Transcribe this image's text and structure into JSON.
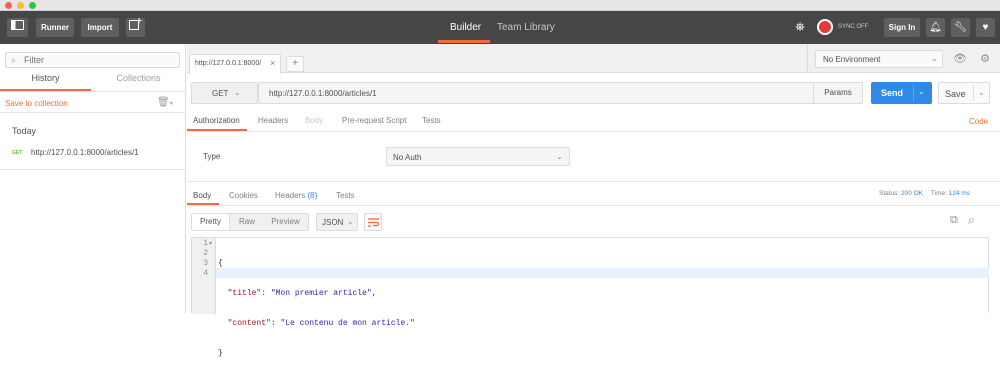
{
  "header": {
    "runner": "Runner",
    "import": "Import",
    "builder": "Builder",
    "team_library": "Team Library",
    "sync": "SYNC OFF",
    "sign_in": "Sign In"
  },
  "sidebar": {
    "filter_placeholder": "Filter",
    "tabs": [
      "History",
      "Collections"
    ],
    "save_to_collection": "Save to collection",
    "group": "Today",
    "items": [
      {
        "method": "GET",
        "url": "http://127.0.0.1:8000/articles/1"
      }
    ]
  },
  "request_tab": {
    "label": "http://127.0.0.1:8000/",
    "close": "×",
    "add": "+"
  },
  "environment": {
    "selected": "No Environment"
  },
  "request": {
    "method": "GET",
    "url": "http://127.0.0.1:8000/articles/1",
    "params": "Params",
    "send": "Send",
    "save": "Save"
  },
  "request_tabs": [
    "Authorization",
    "Headers",
    "Body",
    "Pre-request Script",
    "Tests"
  ],
  "code_link": "Code",
  "auth": {
    "type_label": "Type",
    "type_value": "No Auth"
  },
  "response_tabs": {
    "body": "Body",
    "cookies": "Cookies",
    "headers": "Headers",
    "headers_count": "(8)",
    "tests": "Tests"
  },
  "status": {
    "status_label": "Status:",
    "status_value": "200 OK",
    "time_label": "Time:",
    "time_value": "124 ms"
  },
  "view": {
    "pretty": "Pretty",
    "raw": "Raw",
    "preview": "Preview",
    "format": "JSON"
  },
  "code_lines": [
    {
      "num": "1",
      "text": "{"
    },
    {
      "num": "2",
      "key": "\"title\"",
      "value": "\"Mon premier article\","
    },
    {
      "num": "3",
      "key": "\"content\"",
      "value": "\"Le contenu de mon article.\""
    },
    {
      "num": "4",
      "text": "}"
    }
  ],
  "colors": {
    "accent": "#f26b3a",
    "send": "#2f8ae5",
    "header": "#464646",
    "status_ok": "#2f8ae5",
    "method_get": "#6bbd3c"
  }
}
